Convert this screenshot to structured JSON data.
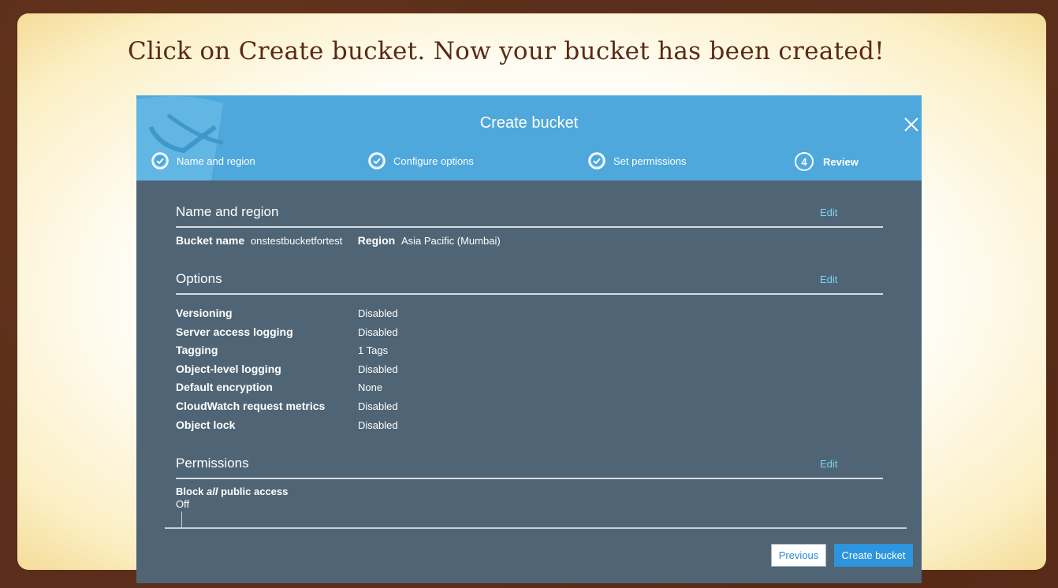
{
  "slide": {
    "title": "Click on Create bucket.  Now your bucket has been created!"
  },
  "dialog": {
    "title": "Create bucket",
    "steps": [
      {
        "label": "Name and region",
        "state": "complete"
      },
      {
        "label": "Configure options",
        "state": "complete"
      },
      {
        "label": "Set permissions",
        "state": "complete"
      },
      {
        "label": "Review",
        "number": "4",
        "state": "active"
      }
    ],
    "name_region": {
      "heading": "Name and region",
      "edit": "Edit",
      "bucket_name_label": "Bucket name",
      "bucket_name_value": "onstestbucketfortest",
      "region_label": "Region",
      "region_value": "Asia Pacific (Mumbai)"
    },
    "options": {
      "heading": "Options",
      "edit": "Edit",
      "rows": [
        {
          "label": "Versioning",
          "value": "Disabled"
        },
        {
          "label": "Server access logging",
          "value": "Disabled"
        },
        {
          "label": "Tagging",
          "value": "1 Tags"
        },
        {
          "label": "Object-level logging",
          "value": "Disabled"
        },
        {
          "label": "Default encryption",
          "value": "None"
        },
        {
          "label": "CloudWatch request metrics",
          "value": "Disabled"
        },
        {
          "label": "Object lock",
          "value": "Disabled"
        }
      ]
    },
    "permissions": {
      "heading": "Permissions",
      "edit": "Edit",
      "block_prefix": "Block ",
      "block_emph": "all",
      "block_suffix": " public access",
      "block_value": "Off"
    },
    "buttons": {
      "previous": "Previous",
      "create": "Create bucket"
    }
  },
  "colors": {
    "header_bg": "#4ea8db",
    "body_bg": "#4f6575",
    "link": "#7ed0f7",
    "primary_button": "#2d95dd",
    "title_text": "#5a2a14"
  },
  "icons": {
    "close": "close-icon",
    "step_done": "check-circle-icon"
  }
}
